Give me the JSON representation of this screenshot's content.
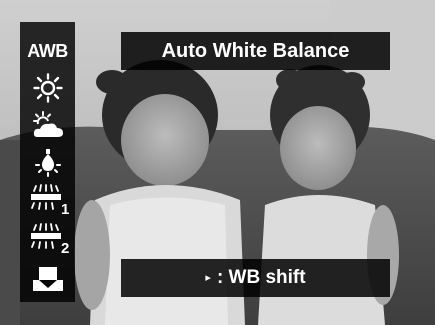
{
  "menu": {
    "title": "Auto White Balance",
    "selected_index": 0,
    "items": [
      {
        "id": "awb",
        "label": "AWB",
        "icon": "awb-text-icon"
      },
      {
        "id": "daylight",
        "label": "",
        "icon": "sun-icon"
      },
      {
        "id": "cloudy",
        "label": "",
        "icon": "cloud-sun-icon"
      },
      {
        "id": "tungsten",
        "label": "",
        "icon": "bulb-icon"
      },
      {
        "id": "fluorescent1",
        "label": "1",
        "icon": "fluorescent-1-icon"
      },
      {
        "id": "fluorescent2",
        "label": "2",
        "icon": "fluorescent-2-icon"
      },
      {
        "id": "custom",
        "label": "",
        "icon": "custom-wb-icon"
      }
    ]
  },
  "hint": {
    "arrow": "▸",
    "text": ": WB shift"
  },
  "colors": {
    "overlay": "#000000",
    "text": "#ffffff"
  }
}
